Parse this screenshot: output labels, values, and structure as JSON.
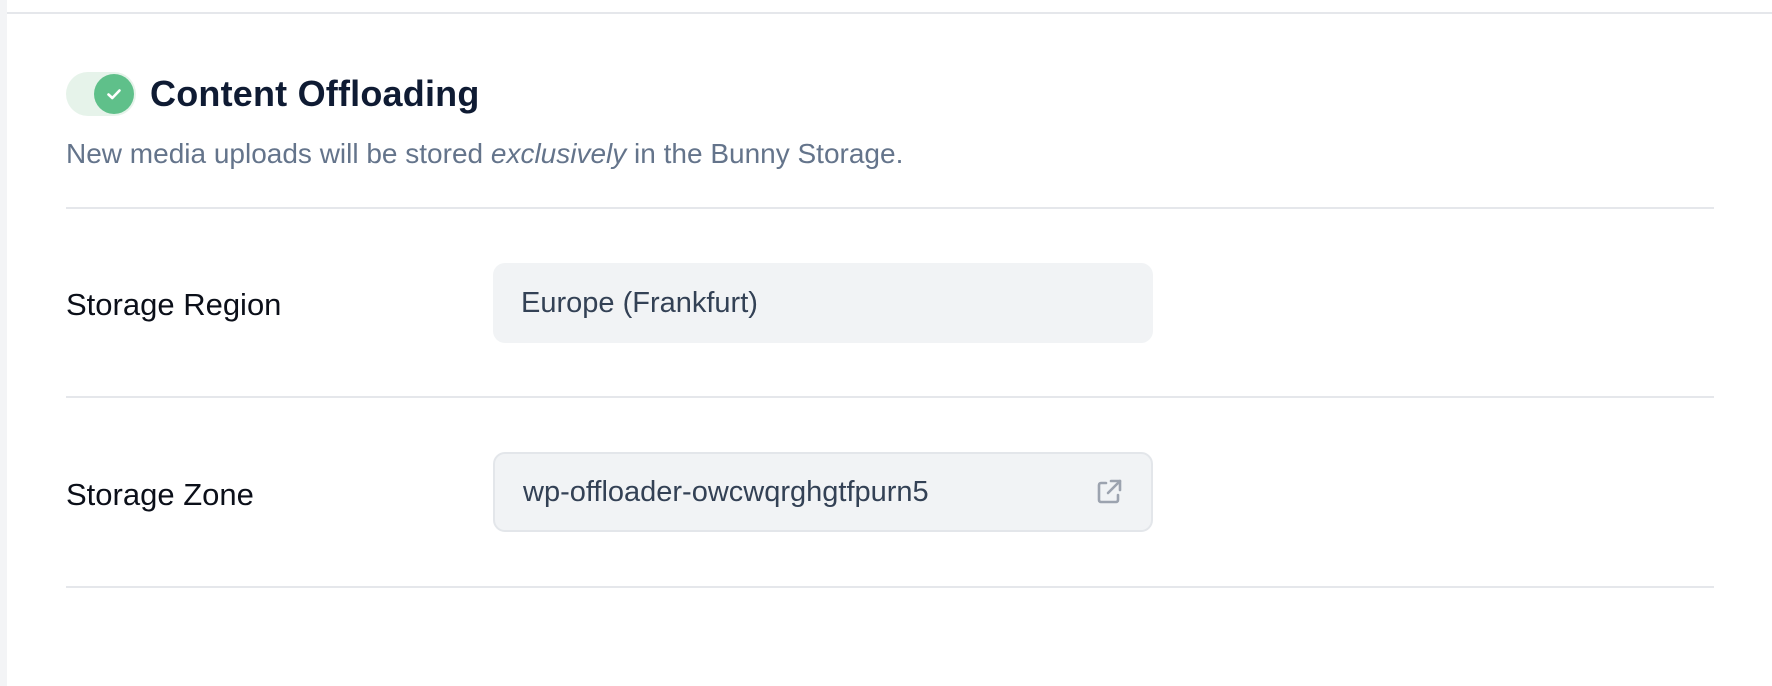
{
  "offloading": {
    "title": "Content Offloading",
    "enabled": true,
    "description_prefix": "New media uploads will be stored ",
    "description_emphasis": "exclusively",
    "description_suffix": " in the Bunny Storage."
  },
  "storage_region": {
    "label": "Storage Region",
    "value": "Europe (Frankfurt)"
  },
  "storage_zone": {
    "label": "Storage Zone",
    "value": "wp-offloader-owcwqrghgtfpurn5",
    "icon": "external-link-icon"
  },
  "colors": {
    "toggle_on": "#5fc08a",
    "toggle_track": "#e6f3ea",
    "title": "#0f1b33",
    "muted_text": "#64748b",
    "field_bg": "#f1f3f5"
  }
}
